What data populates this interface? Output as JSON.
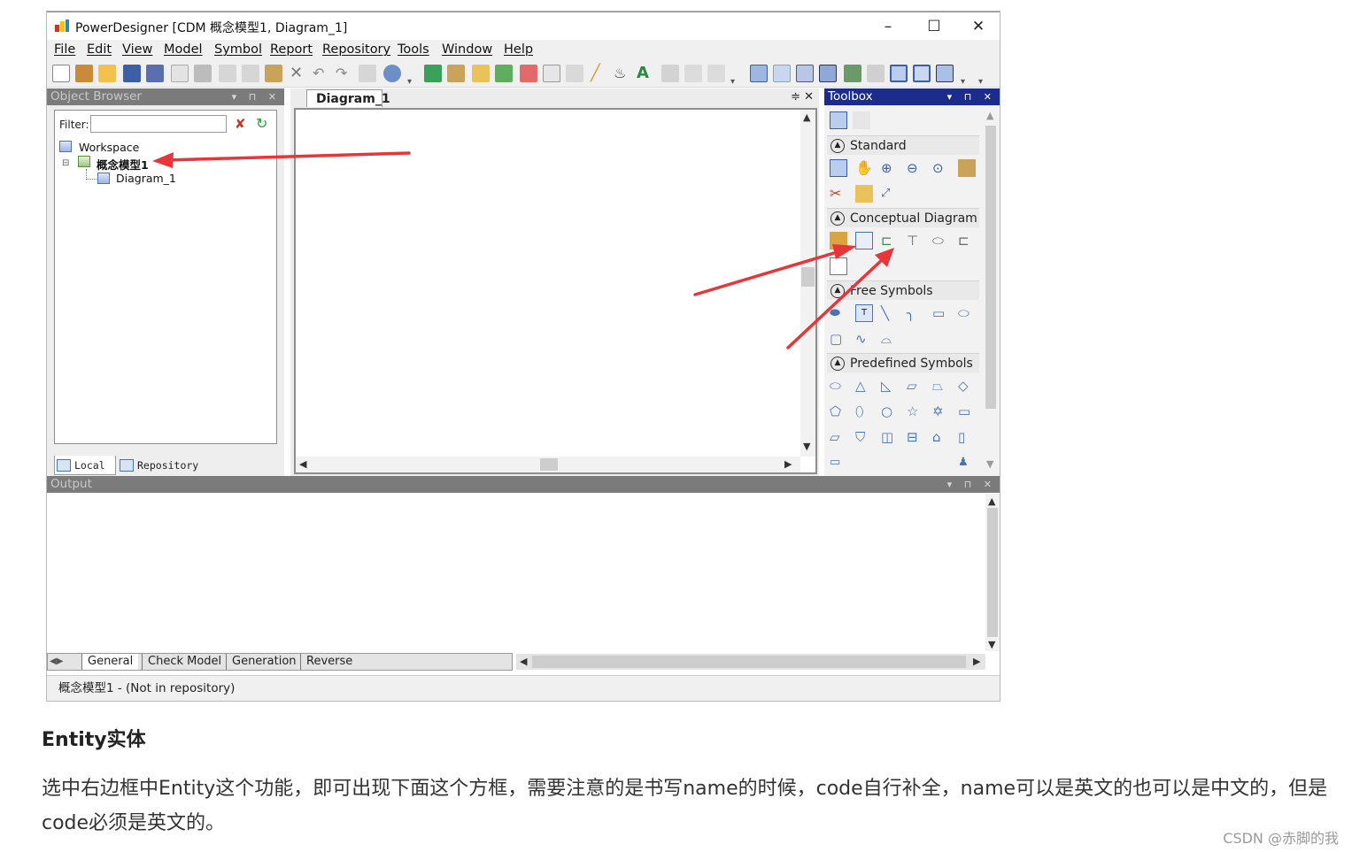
{
  "window": {
    "title": "PowerDesigner [CDM 概念模型1, Diagram_1]",
    "controls": [
      "–",
      "☐",
      "✕"
    ]
  },
  "menu": [
    "File",
    "Edit",
    "View",
    "Model",
    "Symbol",
    "Report",
    "Repository",
    "Tools",
    "Window",
    "Help"
  ],
  "object_browser": {
    "header": "Object Browser",
    "filter_label": "Filter:",
    "filter_value": "",
    "tree": {
      "workspace": "Workspace",
      "model": "概念模型1",
      "diagram": "Diagram_1"
    },
    "tabs": [
      "Local",
      "Repository"
    ]
  },
  "diagram": {
    "tab": "Diagram_1",
    "ctrls": "≑ ✕"
  },
  "toolbox": {
    "header": "Toolbox",
    "sections": [
      "Standard",
      "Conceptual Diagram",
      "Free Symbols",
      "Predefined Symbols"
    ]
  },
  "output": {
    "header": "Output",
    "tabs": [
      "General",
      "Check Model",
      "Generation",
      "Reverse"
    ]
  },
  "status_bar": "概念模型1 - (Not in repository)",
  "article": {
    "heading": "Entity实体",
    "paragraph": "选中右边框中Entity这个功能，即可出现下面这个方框，需要注意的是书写name的时候，code自行补全，name可以是英文的也可以是中文的，但是code必须是英文的。",
    "watermark": "CSDN @赤脚的我"
  },
  "colors": {
    "annotation_arrow": "#e8353a",
    "toolbox_header": "#1c2c8d",
    "panel_header": "#7b7b7b"
  }
}
